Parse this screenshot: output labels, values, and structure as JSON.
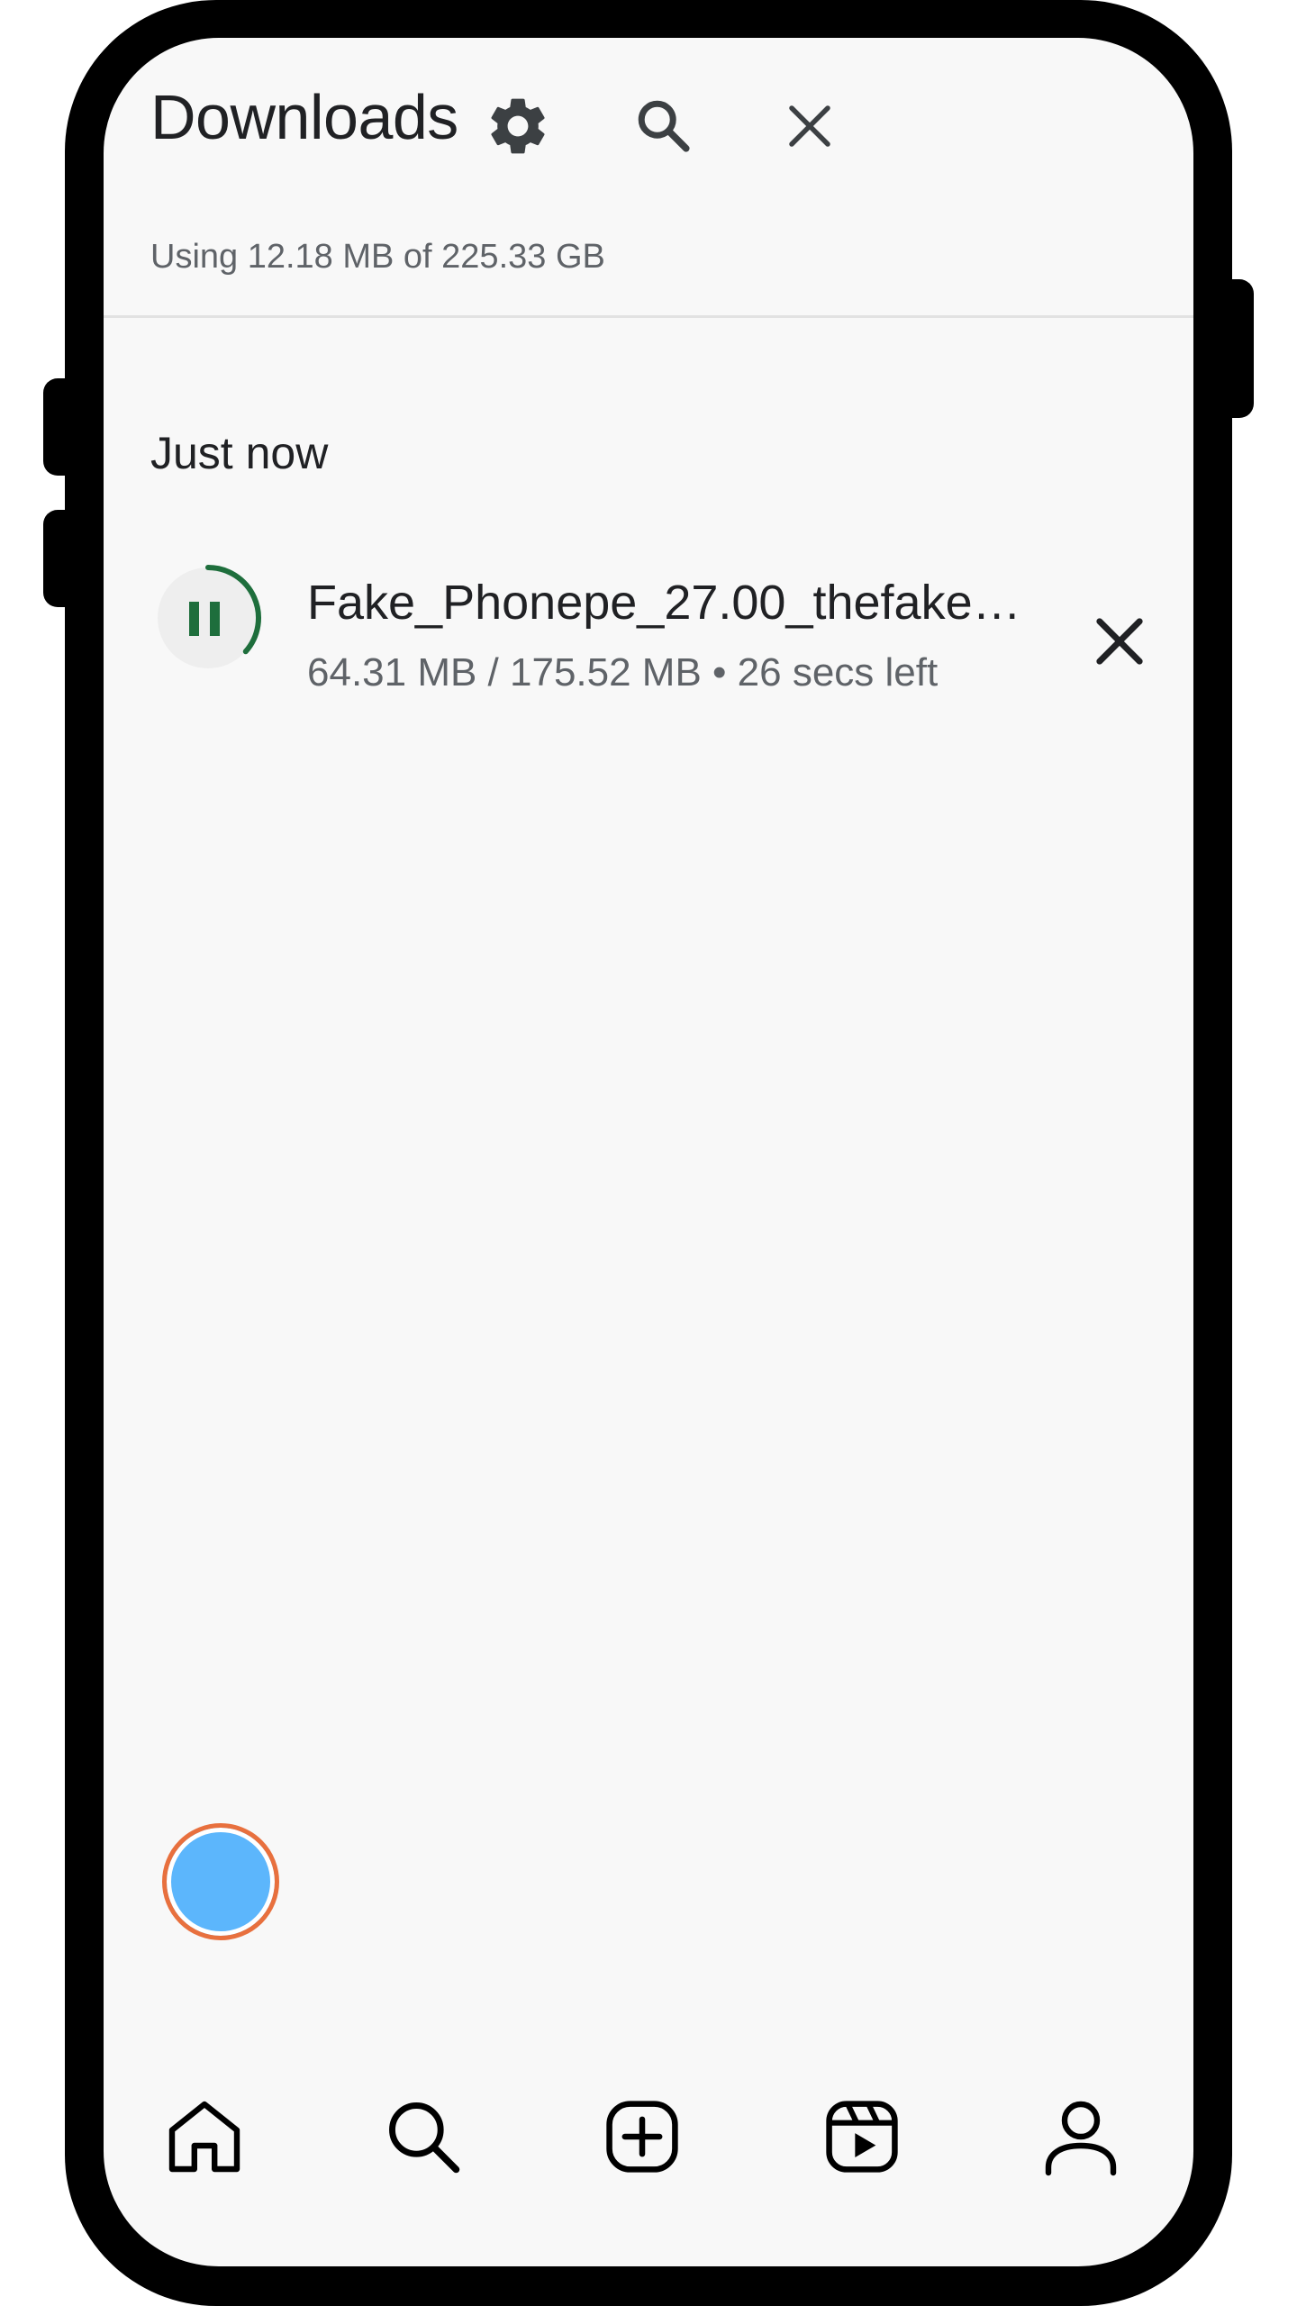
{
  "header": {
    "title": "Downloads",
    "storage_text": "Using 12.18 MB of 225.33 GB",
    "icons": [
      "gear-icon",
      "search-icon",
      "close-icon"
    ]
  },
  "downloads": {
    "section_label": "Just now",
    "items": [
      {
        "file_name": "Fake_Phonepe_27.00_thefakep...",
        "meta": "64.31 MB / 175.52 MB • 26 secs left",
        "downloaded_mb": 64.31,
        "total_mb": 175.52,
        "progress": 0.366,
        "state": "downloading",
        "state_icon": "pause-icon"
      }
    ]
  },
  "bottom_nav": {
    "items": [
      "home-icon",
      "search-icon",
      "create-icon",
      "reels-icon",
      "profile-icon"
    ]
  },
  "colors": {
    "accent_green": "#1e6e3c",
    "avatar_fill": "#5cb6fc",
    "avatar_ring": "#e8703e",
    "background": "#f8f8f8",
    "text_primary": "#202124",
    "text_secondary": "#5f6368"
  }
}
